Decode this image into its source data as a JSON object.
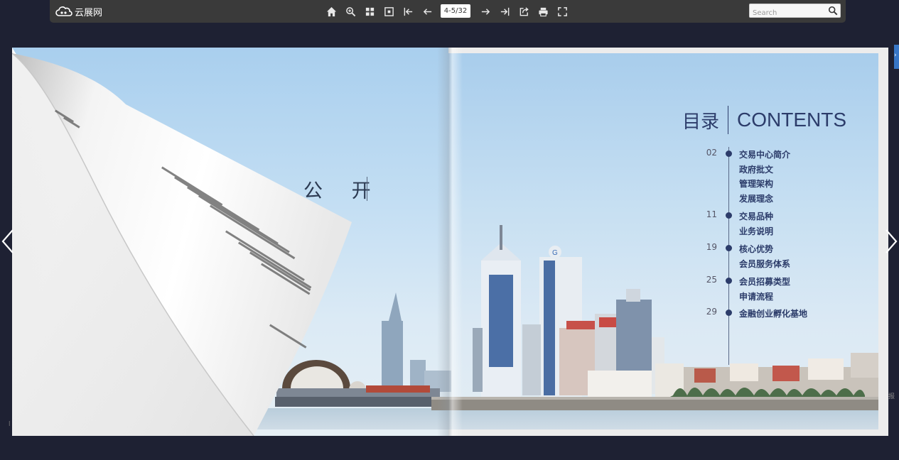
{
  "toolbar": {
    "logo_text": "云展网",
    "page_indicator": "4-5/32",
    "search_placeholder": "Search",
    "icons": [
      "home-icon",
      "zoom-in-icon",
      "thumbnails-icon",
      "fit-page-icon",
      "first-page-icon",
      "prev-page-icon",
      "next-page-icon",
      "last-page-icon",
      "share-icon",
      "print-icon",
      "fullscreen-icon"
    ]
  },
  "left_page": {
    "title": "公  开"
  },
  "toc": {
    "title_cn": "目录",
    "title_en": "CONTENTS",
    "entries": [
      {
        "page": "02",
        "lines": [
          "交易中心简介",
          "政府批文",
          "管理架构",
          "发展理念"
        ]
      },
      {
        "page": "11",
        "lines": [
          "交易品种",
          "业务说明"
        ]
      },
      {
        "page": "19",
        "lines": [
          "核心优势",
          "会员服务体系"
        ]
      },
      {
        "page": "25",
        "lines": [
          "会员招募类型",
          "申请流程"
        ]
      },
      {
        "page": "29",
        "lines": [
          "金融创业孵化基地"
        ]
      }
    ]
  },
  "side": {
    "right_edge_text": "报",
    "left_edge_text": "l"
  },
  "colors": {
    "background": "#1e2133",
    "toolbar": "#3a3a3a",
    "toc_ink": "#2c3c6a",
    "side_tab": "#3776c6"
  }
}
